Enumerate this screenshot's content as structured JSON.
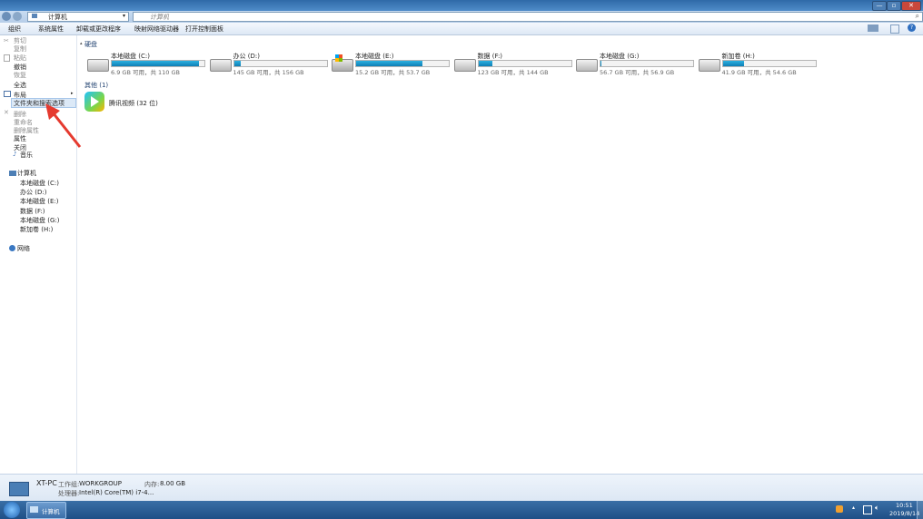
{
  "titlebar": {
    "min_label": "—",
    "max_label": "▫",
    "close_label": "✕"
  },
  "address": {
    "path": "计算机",
    "search_placeholder": "计算机"
  },
  "toolbar": {
    "items": [
      "组织",
      "系统属性",
      "卸载或更改程序",
      "映射网络驱动器",
      "打开控制面板"
    ]
  },
  "menu": {
    "items": [
      {
        "label": "剪切",
        "dim": true
      },
      {
        "label": "复制",
        "dim": true
      },
      {
        "label": "粘贴",
        "dim": true
      },
      {
        "label": "撤销",
        "dim": false
      },
      {
        "label": "恢复",
        "dim": true
      },
      {
        "label": "全选",
        "dim": false
      },
      {
        "label": "布局",
        "dim": false
      },
      {
        "label": "文件夹和搜索选项",
        "dim": false
      },
      {
        "label": "删除",
        "dim": true
      },
      {
        "label": "重命名",
        "dim": true
      },
      {
        "label": "删除属性",
        "dim": true
      },
      {
        "label": "属性",
        "dim": false
      },
      {
        "label": "关闭",
        "dim": false
      }
    ]
  },
  "nav": {
    "music": "音乐",
    "computer": "计算机",
    "drives": [
      "本地磁盘 (C:)",
      "办公 (D:)",
      "本地磁盘 (E:)",
      "数据 (F:)",
      "本地磁盘 (G:)",
      "新加卷 (H:)"
    ],
    "network": "网络"
  },
  "content": {
    "group_drives": "硬盘",
    "group_other": "其他 (1)",
    "drives": [
      {
        "name": "本地磁盘 (C:)",
        "size": "6.9 GB 可用，共 110 GB",
        "used": 0.94
      },
      {
        "name": "办公 (D:)",
        "size": "145 GB 可用，共 156 GB",
        "used": 0.07
      },
      {
        "name": "本地磁盘 (E:)",
        "size": "15.2 GB 可用，共 53.7 GB",
        "used": 0.72
      },
      {
        "name": "数据 (F:)",
        "size": "123 GB 可用，共 144 GB",
        "used": 0.15
      },
      {
        "name": "本地磁盘 (G:)",
        "size": "56.7 GB 可用，共 56.9 GB",
        "used": 0.01
      },
      {
        "name": "新加卷 (H:)",
        "size": "41.9 GB 可用，共 54.6 GB",
        "used": 0.23
      }
    ],
    "other_item": "腾讯视频 (32 位)"
  },
  "details": {
    "pc_name": "XT-PC",
    "workgroup_label": "工作组:",
    "workgroup": "WORKGROUP",
    "memory_label": "内存:",
    "memory": "8.00 GB",
    "cpu_label": "处理器:",
    "cpu": "Intel(R) Core(TM) i7-4..."
  },
  "taskbar": {
    "task_label": "计算机",
    "time": "10:51",
    "date": "2019/8/14"
  },
  "colors": {
    "arrow": "#e53a2f",
    "accent": "#1e6bb8",
    "bar_fill": "#0e7fb5"
  }
}
